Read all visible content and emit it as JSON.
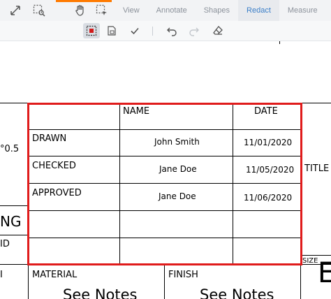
{
  "toolbar": {
    "tools": [
      {
        "name": "fit-page-icon"
      },
      {
        "name": "marquee-zoom-icon"
      },
      {
        "name": "pan-hand-icon"
      },
      {
        "name": "select-region-icon"
      }
    ],
    "tabs": [
      {
        "label": "View"
      },
      {
        "label": "Annotate"
      },
      {
        "label": "Shapes"
      },
      {
        "label": "Redact",
        "active": true
      },
      {
        "label": "Measure"
      }
    ]
  },
  "subtoolbar": {
    "buttons": [
      {
        "name": "redact-area-icon",
        "selected": true
      },
      {
        "name": "redact-page-icon"
      },
      {
        "name": "apply-check-icon"
      },
      {
        "name": "undo-icon"
      },
      {
        "name": "redo-icon"
      },
      {
        "name": "eraser-icon"
      }
    ]
  },
  "document": {
    "left_fragments": {
      "tolerance": "°0.5",
      "ng": "NG",
      "id": "ID",
      "i": "I"
    },
    "table": {
      "headers": {
        "name": "NAME",
        "date": "DATE"
      },
      "rows": [
        {
          "label": "DRAWN",
          "name": "John Smith",
          "date": "11/01/2020"
        },
        {
          "label": "CHECKED",
          "name": "Jane Doe",
          "date": "11/05/2020"
        },
        {
          "label": "APPROVED",
          "name": "Jane Doe",
          "date": "11/06/2020"
        }
      ]
    },
    "title_label": "TITLE",
    "material_label": "MATERIAL",
    "finish_label": "FINISH",
    "material_value": "See Notes",
    "finish_value": "See Notes",
    "size_label": "SIZE",
    "size_value": "E"
  },
  "colors": {
    "redaction_box": "#e01b1b",
    "active_tab": "#3a7ec8",
    "accent": "#ff7a00"
  }
}
